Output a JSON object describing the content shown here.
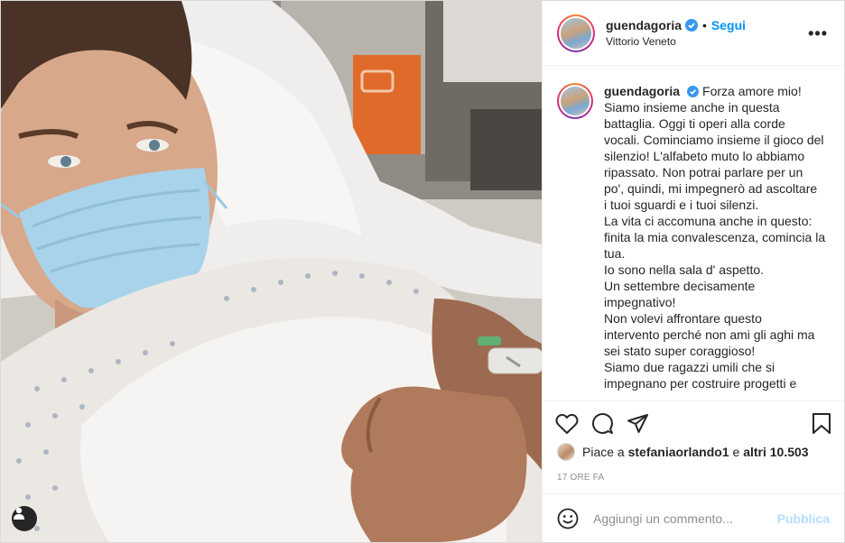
{
  "post": {
    "author": {
      "username": "guendagoria",
      "verified": true,
      "location": "Vittorio Veneto"
    },
    "follow_label": "Segui",
    "separator": "•",
    "more_label": "•••",
    "caption_lines": [
      "Forza amore mio!",
      "Siamo insieme anche in questa",
      "battaglia. Oggi ti operi alla corde",
      "vocali. Cominciamo insieme il gioco del",
      "silenzio! L'alfabeto muto lo abbiamo",
      "ripassato. Non potrai parlare per un",
      "po', quindi, mi impegnerò ad ascoltare",
      "i tuoi sguardi e i tuoi silenzi.",
      "La vita ci accomuna anche in questo:",
      "finita la mia convalescenza, comincia la",
      "tua.",
      "Io sono nella sala d' aspetto.",
      "Un settembre decisamente",
      "impegnativo!",
      "Non volevi affrontare questo",
      "intervento perché non ami gli aghi ma",
      "sei stato super coraggioso!",
      "Siamo due ragazzi umili che si",
      "impegnano per costruire progetti e"
    ],
    "likes": {
      "prefix": "Piace a",
      "user": "stefaniaorlando1",
      "middle": "e",
      "others": "altri 10.503"
    },
    "timestamp": "17 ORE FA",
    "comment_box": {
      "placeholder": "Aggiungi un commento...",
      "publish_label": "Pubblica"
    },
    "icons": {
      "verified": "verified-badge-icon",
      "like": "heart-icon",
      "comment": "comment-bubble-icon",
      "share": "paper-plane-icon",
      "save": "bookmark-icon",
      "emoji": "smiley-icon",
      "tagged": "user-tag-icon"
    },
    "colors": {
      "link_blue": "#0095f6",
      "verified_blue": "#3897f0",
      "publish_disabled": "#b2dffc",
      "muted": "#8e8e8e"
    }
  }
}
